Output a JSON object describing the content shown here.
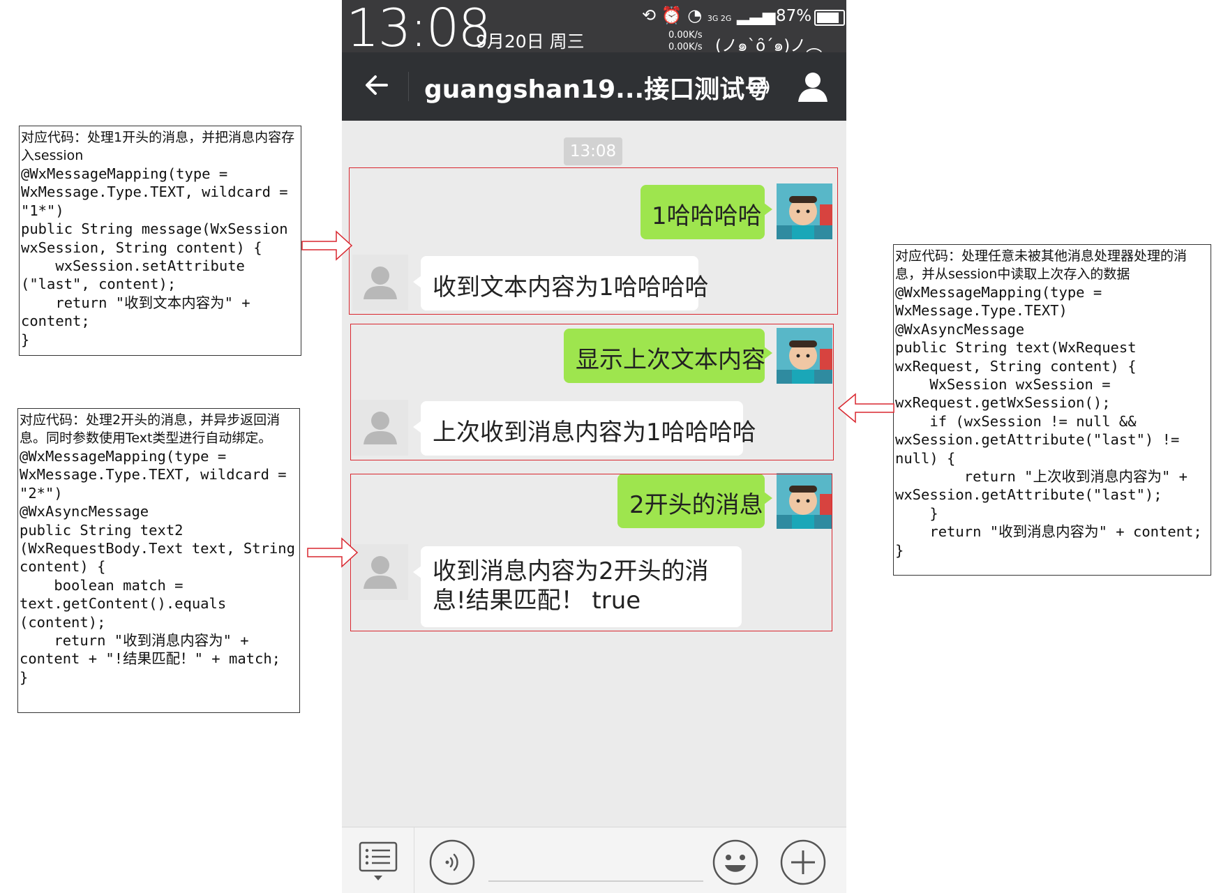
{
  "status_bar": {
    "time": "13:08",
    "date": "9月20日 周三",
    "net_speed_up": "0.00K/s",
    "net_speed_down": "0.00K/s",
    "network": "3G 2G",
    "battery_percent": "87%",
    "battery_level": 0.87,
    "kaomoji": "(ノ๑`ȏ´๑)ノ︵"
  },
  "title_bar": {
    "title": "guangshan19...接口测试号"
  },
  "chat": {
    "timestamp": "13:08",
    "messages": [
      {
        "from": "me",
        "text": "1哈哈哈哈"
      },
      {
        "from": "bot",
        "text": "收到文本内容为1哈哈哈哈"
      },
      {
        "from": "me",
        "text": "显示上次文本内容"
      },
      {
        "from": "bot",
        "text": "上次收到消息内容为1哈哈哈哈"
      },
      {
        "from": "me",
        "text": "2开头的消息"
      },
      {
        "from": "bot",
        "text": "收到消息内容为2开头的消息!结果匹配！ true"
      }
    ]
  },
  "notes": [
    {
      "heading": "对应代码：处理1开头的消息，并把消息内容存入session",
      "code": "@WxMessageMapping(type =\nWxMessage.Type.TEXT, wildcard =\n\"1*\")\npublic String message(WxSession\nwxSession, String content) {\n    wxSession.setAttribute\n(\"last\", content);\n    return \"收到文本内容为\" +\ncontent;\n}"
    },
    {
      "heading": "对应代码：处理2开头的消息，并异步返回消息。同时参数使用Text类型进行自动绑定。",
      "code": "@WxMessageMapping(type =\nWxMessage.Type.TEXT, wildcard =\n\"2*\")\n@WxAsyncMessage\npublic String text2\n(WxRequestBody.Text text, String\ncontent) {\n    boolean match =\ntext.getContent().equals\n(content);\n    return \"收到消息内容为\" +\ncontent + \"!结果匹配！\" + match;\n}"
    },
    {
      "heading": "对应代码：处理任意未被其他消息处理器处理的消息，并从session中读取上次存入的数据",
      "code": "@WxMessageMapping(type =\nWxMessage.Type.TEXT)\n@WxAsyncMessage\npublic String text(WxRequest\nwxRequest, String content) {\n    WxSession wxSession =\nwxRequest.getWxSession();\n    if (wxSession != null &&\nwxSession.getAttribute(\"last\") !=\nnull) {\n        return \"上次收到消息内容为\" +\nwxSession.getAttribute(\"last\");\n    }\n    return \"收到消息内容为\" + content;\n}"
    }
  ],
  "colors": {
    "header_bg": "#2f3134",
    "status_bg": "#3a3a3c",
    "chat_bg": "#ebebeb",
    "bubble_out": "#9ee54e",
    "bubble_in": "#ffffff",
    "highlight": "#d9262e"
  },
  "icons": {
    "back": "arrow-left-icon",
    "ear": "ear-icon",
    "profile": "person-icon",
    "menu": "list-menu-icon",
    "voice": "voice-icon",
    "emoji": "emoji-icon",
    "plus": "plus-icon"
  }
}
